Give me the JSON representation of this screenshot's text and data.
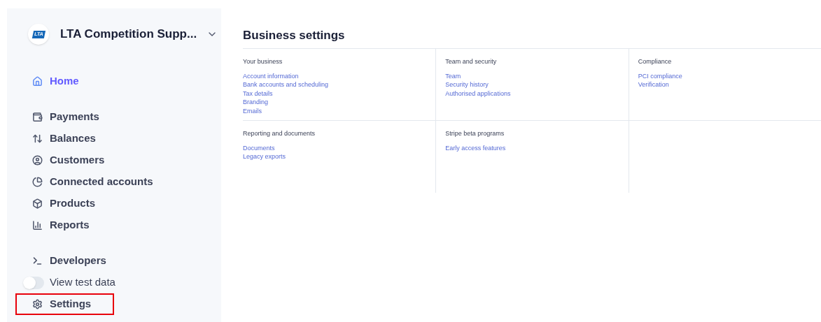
{
  "account": {
    "logo": "LTA",
    "name": "LTA Competition Supp..."
  },
  "sidebar": {
    "sections": [
      {
        "items": [
          {
            "kind": "link",
            "label": "Home",
            "selected": true,
            "highlighted": false
          }
        ]
      },
      {
        "items": [
          {
            "kind": "link",
            "label": "Payments",
            "selected": false,
            "highlighted": false
          },
          {
            "kind": "link",
            "label": "Balances",
            "selected": false,
            "highlighted": false
          },
          {
            "kind": "link",
            "label": "Customers",
            "selected": false,
            "highlighted": false
          },
          {
            "kind": "link",
            "label": "Connected accounts",
            "selected": false,
            "highlighted": false
          },
          {
            "kind": "link",
            "label": "Products",
            "selected": false,
            "highlighted": false
          },
          {
            "kind": "link",
            "label": "Reports",
            "selected": false,
            "highlighted": false
          }
        ]
      },
      {
        "items": [
          {
            "kind": "link",
            "label": "Developers",
            "selected": false,
            "highlighted": false
          },
          {
            "kind": "toggle",
            "label": "View test data",
            "on": false,
            "highlighted": false
          },
          {
            "kind": "link",
            "label": "Settings",
            "selected": false,
            "highlighted": true
          }
        ]
      }
    ]
  },
  "page": {
    "title": "Business settings",
    "sections": [
      {
        "title": "Your business",
        "links": [
          "Account information",
          "Bank accounts and scheduling",
          "Tax details",
          "Branding",
          "Emails"
        ]
      },
      {
        "title": "Team and security",
        "links": [
          "Team",
          "Security history",
          "Authorised applications"
        ]
      },
      {
        "title": "Compliance",
        "links": [
          "PCI compliance",
          "Verification"
        ]
      },
      {
        "title": "Reporting and documents",
        "links": [
          "Documents",
          "Legacy exports"
        ]
      },
      {
        "title": "Stripe beta programs",
        "links": [
          "Early access features"
        ]
      }
    ]
  }
}
